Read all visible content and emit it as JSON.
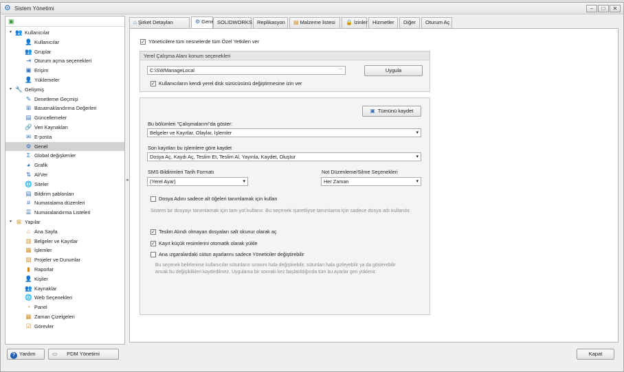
{
  "window": {
    "title": "Sistem Yönetimi",
    "min": "‒",
    "max": "□",
    "close": "✕"
  },
  "sidebar": {
    "header_icon": "▣",
    "groups": [
      {
        "label": "Kullanıcılar",
        "icon": "users-icon",
        "glyph": "👥",
        "color": "#2b6cb8",
        "items": [
          {
            "label": "Kullanıcılar",
            "glyph": "👤",
            "icon": "user-icon"
          },
          {
            "label": "Gruplar",
            "glyph": "👥",
            "icon": "groups-icon"
          },
          {
            "label": "Oturum açma seçenekleri",
            "glyph": "⇥",
            "icon": "login-icon"
          },
          {
            "label": "Erişim",
            "glyph": "▣",
            "icon": "access-icon"
          },
          {
            "label": "Yüklemeler",
            "glyph": "👤",
            "icon": "upload-icon"
          }
        ]
      },
      {
        "label": "Gelişmiş",
        "icon": "wrench-icon",
        "glyph": "🔧",
        "color": "#2b6cb8",
        "items": [
          {
            "label": "Denetleme Geçmişi",
            "glyph": "✎",
            "icon": "audit-icon"
          },
          {
            "label": "Basamaklandırma Değerleri",
            "glyph": "⊞",
            "icon": "cascade-icon"
          },
          {
            "label": "Güncellemeler",
            "glyph": "▤",
            "icon": "updates-icon"
          },
          {
            "label": "Veri Kaynakları",
            "glyph": "🔗",
            "icon": "datasource-icon"
          },
          {
            "label": "E-posta",
            "glyph": "✉",
            "icon": "email-icon"
          },
          {
            "label": "Genel",
            "glyph": "⚙",
            "icon": "gear-icon",
            "selected": true
          },
          {
            "label": "Global değişkenler",
            "glyph": "Σ",
            "icon": "sigma-icon"
          },
          {
            "label": "Grafik",
            "glyph": "◕",
            "icon": "chart-icon"
          },
          {
            "label": "Al/Ver",
            "glyph": "⇅",
            "icon": "transfer-icon"
          },
          {
            "label": "Siteler",
            "glyph": "🌐",
            "icon": "globe-icon"
          },
          {
            "label": "Bildirim şablonları",
            "glyph": "▤",
            "icon": "template-icon"
          },
          {
            "label": "Numaralama düzenleri",
            "glyph": "#",
            "icon": "hash-icon"
          },
          {
            "label": "Numaralandırma Listeleri",
            "glyph": "☰",
            "icon": "list-icon"
          }
        ]
      },
      {
        "label": "Yapılar",
        "icon": "structure-icon",
        "glyph": "⊞",
        "color": "#d08a1a",
        "items": [
          {
            "label": "Ana Sayfa",
            "glyph": "⌂",
            "icon": "home-icon"
          },
          {
            "label": "Belgeler ve Kayıtlar",
            "glyph": "▥",
            "icon": "documents-icon"
          },
          {
            "label": "İşlemler",
            "glyph": "▦",
            "icon": "transactions-icon"
          },
          {
            "label": "Projeler ve Durumlar",
            "glyph": "▨",
            "icon": "projects-icon"
          },
          {
            "label": "Raporlar",
            "glyph": "▮",
            "icon": "reports-icon"
          },
          {
            "label": "Kişiler",
            "glyph": "👤",
            "icon": "contacts-icon"
          },
          {
            "label": "Kaynaklar",
            "glyph": "👥",
            "icon": "resources-icon"
          },
          {
            "label": "Web Seçenekleri",
            "glyph": "🌐",
            "icon": "web-icon"
          },
          {
            "label": "Panel",
            "glyph": "◔",
            "icon": "panel-icon"
          },
          {
            "label": "Zaman Çizelgeleri",
            "glyph": "▦",
            "icon": "timesheet-icon"
          },
          {
            "label": "Görevler",
            "glyph": "☑",
            "icon": "tasks-icon"
          }
        ]
      }
    ]
  },
  "tabs": [
    {
      "label": "Şirket Detayları",
      "glyph": "⌂",
      "icon": "home-icon"
    },
    {
      "label": "Genel",
      "glyph": "⚙",
      "icon": "gear-icon",
      "active": true
    },
    {
      "label": "SOLIDWORKS",
      "glyph": "",
      "icon": ""
    },
    {
      "label": "Replikasyon",
      "glyph": "",
      "icon": ""
    },
    {
      "label": "Malzeme listesi",
      "glyph": "▤",
      "icon": "bom-icon"
    },
    {
      "label": "İzinler",
      "glyph": "🔒",
      "icon": "lock-icon"
    },
    {
      "label": "Hizmetler",
      "glyph": "",
      "icon": ""
    },
    {
      "label": "Diğer",
      "glyph": "",
      "icon": ""
    },
    {
      "label": "Oturum Aç",
      "glyph": "",
      "icon": ""
    }
  ],
  "general": {
    "admin_all_rights": {
      "label": "Yöneticilere tüm nesnelerde tüm Özel Yetkileri ver",
      "checked": "✓"
    },
    "workspace": {
      "title": "Yerel Çalışma Alanı konum seçenekleri",
      "path": "C:\\SWManageLocal",
      "browse": "···",
      "apply": "Uygula",
      "allow_user_drive": {
        "label": "Kullanıcıların kendi yerel disk sürücüsünü değiştirmesine izin ver",
        "checked": "✓"
      }
    },
    "save_all": "Tümünü kaydet",
    "show_sections": {
      "label": "Bu bölümleri \"Çalışmalarım\"da göster:",
      "value": "Belgeler ve Kayıtlar, Olaylar, İşlemler"
    },
    "save_recent": {
      "label": "Son kayıtları bu işlemlere göre kaydet",
      "value": "Dosya Aç, Kaydı Aç, Teslim Et, Teslim Al, Yayınla, Kaydet, Oluştur"
    },
    "sms_format": {
      "label": "SMS Bildirimleri Tarih Formatı",
      "value": "(Yerel Ayar)"
    },
    "note_edit": {
      "label": "Not Düzenleme/Silme Seçenekleri",
      "value": "Her Zaman"
    },
    "filename_child": {
      "label": "Dosya Adını sadece alt öğeleri tanımlamak için kullan",
      "checked": "",
      "help": "Sistem bir dosyayı tanımlamak için tam yol kullanır. Bu seçenek işaretliyse tanımlama için sadece dosya adı kullanılır."
    },
    "readonly_open": {
      "label": "Teslim Alındı olmayan dosyaları salt okunur olarak aç",
      "checked": "✓"
    },
    "load_thumbs": {
      "label": "Kayıt küçük resimlerini otomatik olarak yükle",
      "checked": "✓"
    },
    "grid_admin_only": {
      "label": "Ana ızgaralardaki sütun ayarlarını sadece Yöneticiler değiştirebilir",
      "checked": "",
      "help1": "Bu seçenek belirlenirse kullanıcılar sütunların sırasını hala değiştirebilir, sütunları hala gizleyebilir ya da gösterebilir",
      "help2": "ancak bu değişiklikleri kaydedilmez. Uygulama bir sonraki kez başlatıldığında tüm bu ayarlar geri yüklenir."
    }
  },
  "footer": {
    "help": "Yardım",
    "pdm": "PDM Yönetimi",
    "close": "Kapat"
  }
}
